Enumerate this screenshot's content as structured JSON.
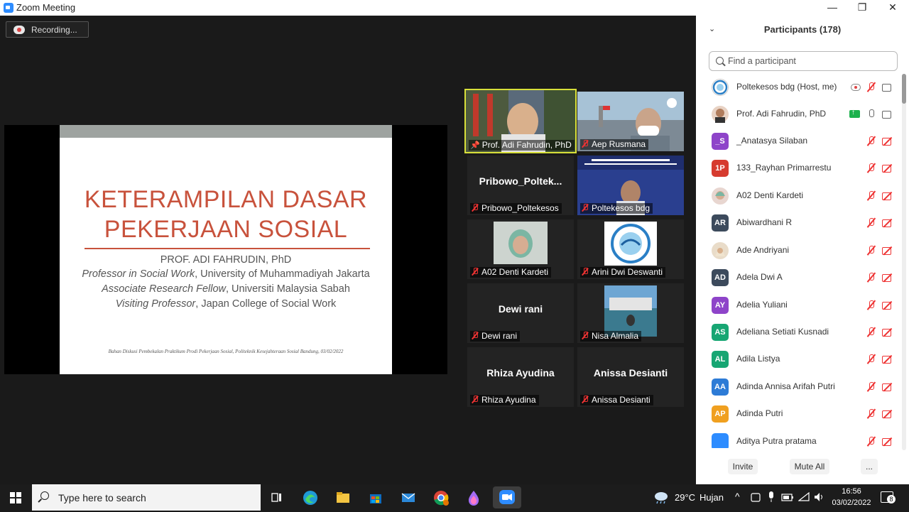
{
  "window": {
    "title": "Zoom Meeting",
    "minimize": "—",
    "restore": "❐",
    "close": "✕"
  },
  "recording": {
    "label": "Recording..."
  },
  "slide": {
    "title_line1": "KETERAMPILAN DASAR",
    "title_line2": "PEKERJAAN SOSIAL",
    "presenter": "PROF. ADI FAHRUDIN, PhD",
    "line2_role": "Professor in Social Work",
    "line2_inst": ", University of  Muhammadiyah Jakarta",
    "line3_role": "Associate Research Fellow",
    "line3_inst": ", Universiti Malaysia Sabah",
    "line4_role": "Visiting Professor",
    "line4_inst": ", Japan College of Social Work",
    "footer": "Bahan Diskusi Pembekalan Praktikum Prodi Pekerjaan Sosial, Politeknik Kesejahteraan Sosial Bandung, 03/02/2022"
  },
  "tiles": [
    {
      "name": "Prof. Adi Fahrudin, PhD",
      "big": ""
    },
    {
      "name": "Aep Rusmana",
      "big": ""
    },
    {
      "name": "Pribowo_Poltekesos",
      "big": "Pribowo_Poltek..."
    },
    {
      "name": "Poltekesos bdg",
      "big": ""
    },
    {
      "name": "A02 Denti Kardeti",
      "big": ""
    },
    {
      "name": "Arini Dwi Deswanti",
      "big": ""
    },
    {
      "name": "Dewi rani",
      "big": "Dewi rani"
    },
    {
      "name": "Nisa Almalia",
      "big": ""
    },
    {
      "name": "Rhiza Ayudina",
      "big": "Rhiza Ayudina"
    },
    {
      "name": "Anissa Desianti",
      "big": "Anissa Desianti"
    }
  ],
  "participants": {
    "header": "Participants (178)",
    "search_placeholder": "Find a participant",
    "list": [
      {
        "name": "Poltekesos bdg (Host, me)",
        "initials": "",
        "color": "#ffffff"
      },
      {
        "name": "Prof. Adi Fahrudin, PhD",
        "initials": "",
        "color": "#ffffff"
      },
      {
        "name": "_Anatasya Silaban",
        "initials": "_S",
        "color": "#8e44c9"
      },
      {
        "name": "133_Rayhan Primarrestu",
        "initials": "1P",
        "color": "#d63b2f"
      },
      {
        "name": "A02 Denti Kardeti",
        "initials": "",
        "color": "#e8d6d0"
      },
      {
        "name": "Abiwardhani R",
        "initials": "AR",
        "color": "#3c4a5c"
      },
      {
        "name": "Ade Andriyani",
        "initials": "",
        "color": "#e9dcc9"
      },
      {
        "name": "Adela Dwi A",
        "initials": "AD",
        "color": "#3c4a5c"
      },
      {
        "name": "Adelia Yuliani",
        "initials": "AY",
        "color": "#8e44c9"
      },
      {
        "name": "Adeliana Setiati Kusnadi",
        "initials": "AS",
        "color": "#17a673"
      },
      {
        "name": "Adila Listya",
        "initials": "AL",
        "color": "#17a673"
      },
      {
        "name": "Adinda Annisa Arifah Putri",
        "initials": "AA",
        "color": "#2d7bd6"
      },
      {
        "name": "Adinda Putri",
        "initials": "AP",
        "color": "#f0a020"
      },
      {
        "name": "Aditya Putra pratama",
        "initials": "",
        "color": "#2d8cff"
      }
    ],
    "invite": "Invite",
    "mute_all": "Mute All",
    "more": "..."
  },
  "taskbar": {
    "search_placeholder": "Type here to search",
    "weather_temp": "29°C",
    "weather_text": "Hujan",
    "time": "16:56",
    "date": "03/02/2022",
    "notifications": "8"
  }
}
